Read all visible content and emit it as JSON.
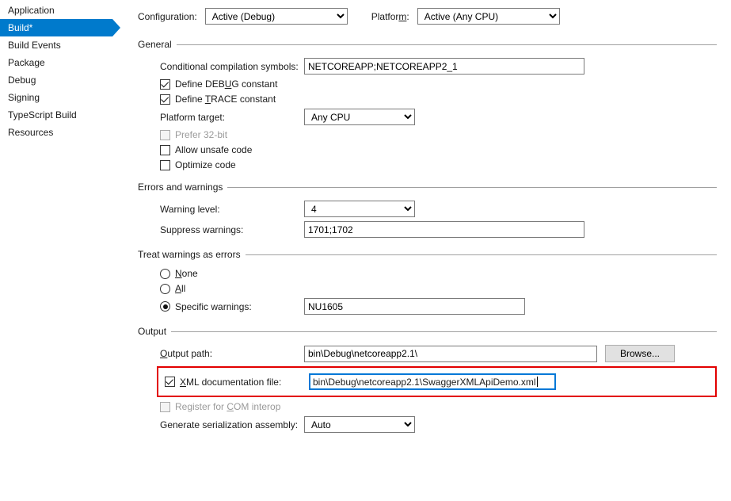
{
  "sidebar": {
    "items": [
      {
        "label": "Application"
      },
      {
        "label": "Build*"
      },
      {
        "label": "Build Events"
      },
      {
        "label": "Package"
      },
      {
        "label": "Debug"
      },
      {
        "label": "Signing"
      },
      {
        "label": "TypeScript Build"
      },
      {
        "label": "Resources"
      }
    ]
  },
  "toprow": {
    "config_label_pre": "Confi",
    "config_label_mn": "g",
    "config_label_post": "uration:",
    "config_value": "Active (Debug)",
    "platform_label_pre": "Platfor",
    "platform_label_mn": "m",
    "platform_label_post": ":",
    "platform_value": "Active (Any CPU)"
  },
  "sections": {
    "general": {
      "title": "General",
      "cond_label": "Conditional compilation symbols:",
      "cond_value": "NETCOREAPP;NETCOREAPP2_1",
      "debug_pre": "Define DEB",
      "debug_mn": "U",
      "debug_post": "G constant",
      "trace_pre": "Define ",
      "trace_mn": "T",
      "trace_post": "RACE constant",
      "pt_label": "Platform target:",
      "pt_value": "Any CPU",
      "p32": "Prefer 32-bit",
      "unsafe": "Allow unsafe code",
      "optimize": "Optimize code"
    },
    "errors": {
      "title": "Errors and warnings",
      "wl_label": "Warning level:",
      "wl_value": "4",
      "sw_label": "Suppress warnings:",
      "sw_value": "1701;1702"
    },
    "twae": {
      "title": "Treat warnings as errors",
      "none_mn": "N",
      "none_post": "one",
      "all_mn": "A",
      "all_post": "ll",
      "specific": "Specific warnings:",
      "specific_value": "NU1605"
    },
    "output": {
      "title": "Output",
      "op_label_mn": "O",
      "op_label_post": "utput path:",
      "op_value": "bin\\Debug\\netcoreapp2.1\\",
      "browse": "Browse...",
      "xml_pre": "",
      "xml_mn": "X",
      "xml_post": "ML documentation file:",
      "xml_value": "bin\\Debug\\netcoreapp2.1\\SwaggerXMLApiDemo.xml",
      "com_pre": "Register for ",
      "com_mn": "C",
      "com_post": "OM interop",
      "gsa_label": "Generate serialization assembly:",
      "gsa_value": "Auto"
    }
  }
}
